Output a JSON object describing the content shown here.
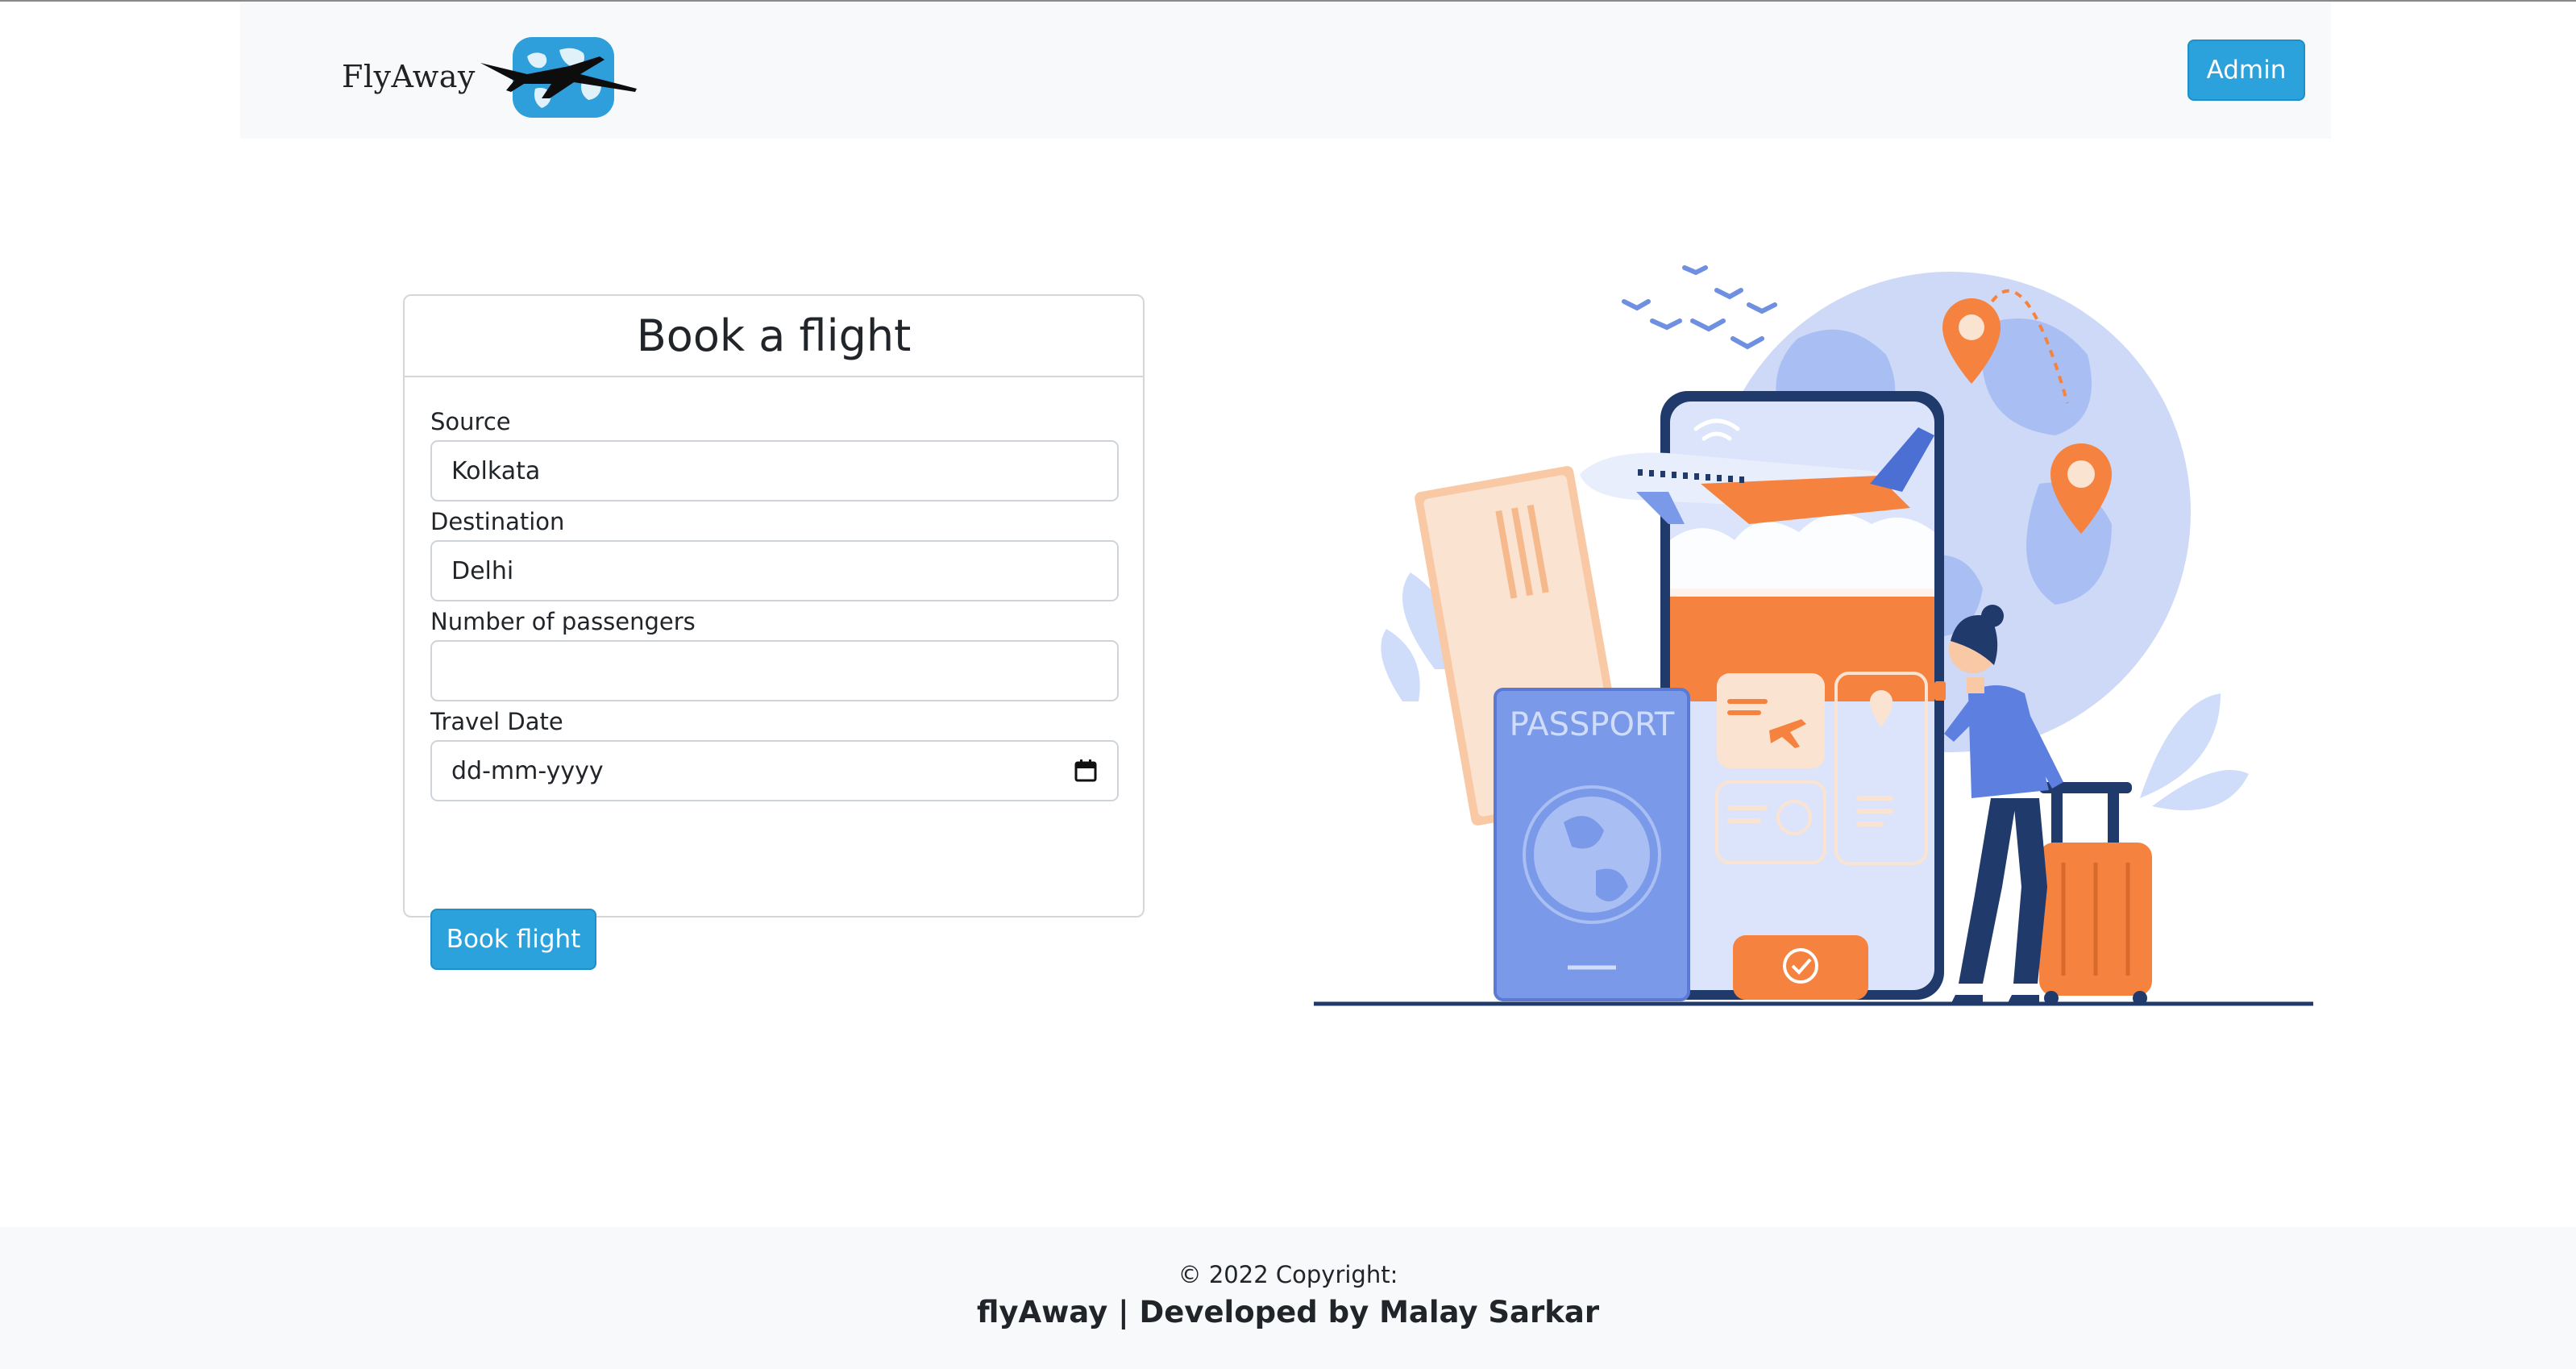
{
  "navbar": {
    "brand": "FlyAway",
    "admin_label": "Admin"
  },
  "booking_form": {
    "title": "Book a flight",
    "source": {
      "label": "Source",
      "value": "Kolkata"
    },
    "destination": {
      "label": "Destination",
      "value": "Delhi"
    },
    "passengers": {
      "label": "Number of passengers",
      "value": ""
    },
    "travel_date": {
      "label": "Travel Date",
      "placeholder": "dd-mm-yyyy"
    },
    "submit_label": "Book flight"
  },
  "illustration": {
    "passport_text": "PASSPORT"
  },
  "footer": {
    "copyright": "© 2022 Copyright:",
    "credit": "flyAway | Developed by Malay Sarkar"
  },
  "colors": {
    "navbar_bg": "#f8f9fa",
    "primary_button": "#2ca2dc",
    "illustration_orange": "#f5833f",
    "illustration_blue": "#7a99e8"
  }
}
